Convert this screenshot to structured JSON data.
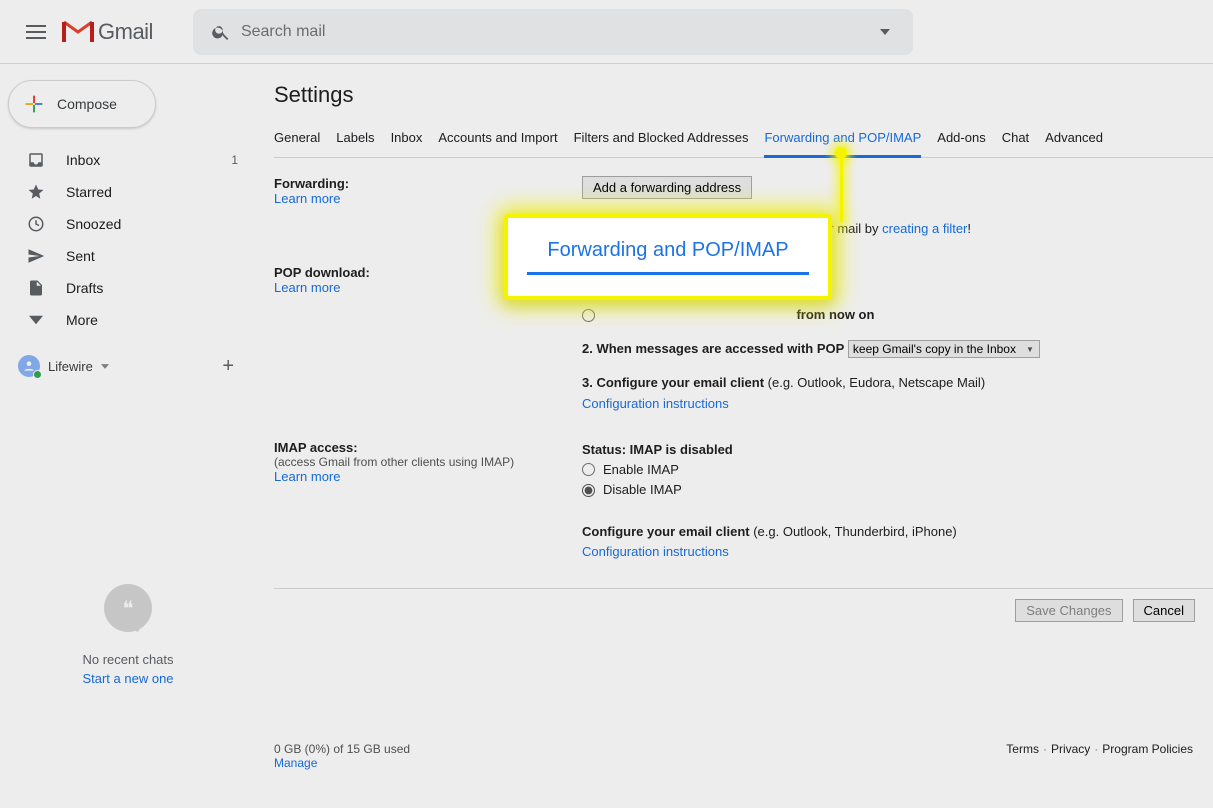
{
  "header": {
    "product": "Gmail",
    "search_placeholder": "Search mail"
  },
  "compose_label": "Compose",
  "sidebar": {
    "items": [
      {
        "label": "Inbox",
        "icon": "inbox",
        "count": "1"
      },
      {
        "label": "Starred",
        "icon": "star",
        "count": ""
      },
      {
        "label": "Snoozed",
        "icon": "clock",
        "count": ""
      },
      {
        "label": "Sent",
        "icon": "send",
        "count": ""
      },
      {
        "label": "Drafts",
        "icon": "file",
        "count": ""
      },
      {
        "label": "More",
        "icon": "chevron",
        "count": ""
      }
    ],
    "hangout_label": "Lifewire",
    "no_chats": "No recent chats",
    "start_chat": "Start a new one"
  },
  "settings": {
    "title": "Settings",
    "tabs": [
      "General",
      "Labels",
      "Inbox",
      "Accounts and Import",
      "Filters and Blocked Addresses",
      "Forwarding and POP/IMAP",
      "Add-ons",
      "Chat",
      "Advanced"
    ],
    "active_tab": 5,
    "forwarding": {
      "heading": "Forwarding:",
      "learn_more": "Learn more",
      "button": "Add a forwarding address",
      "tip_prefix": "Tip: You can also forward only some of your mail by ",
      "tip_link": "creating a filter",
      "tip_suffix": "!"
    },
    "pop": {
      "heading": "POP download:",
      "learn_more": "Learn more",
      "step1_hidden": "from now on",
      "step2_label": "2. When messages are accessed with POP",
      "step2_select": "keep Gmail's copy in the Inbox",
      "step3_label": "3. Configure your email client",
      "step3_note": " (e.g. Outlook, Eudora, Netscape Mail)",
      "config_link": "Configuration instructions"
    },
    "imap": {
      "heading": "IMAP access:",
      "sub": "(access Gmail from other clients using IMAP)",
      "learn_more": "Learn more",
      "status_label": "Status: ",
      "status_value": "IMAP is disabled",
      "enable_label": "Enable IMAP",
      "disable_label": "Disable IMAP",
      "config_label": "Configure your email client",
      "config_note": " (e.g. Outlook, Thunderbird, iPhone)",
      "config_link": "Configuration instructions"
    },
    "save": "Save Changes",
    "cancel": "Cancel"
  },
  "callout_text": "Forwarding and POP/IMAP",
  "footer": {
    "storage": "0 GB (0%) of 15 GB used",
    "manage": "Manage",
    "terms": "Terms",
    "privacy": "Privacy",
    "policies": "Program Policies"
  },
  "icons": {
    "quote": "❝"
  }
}
